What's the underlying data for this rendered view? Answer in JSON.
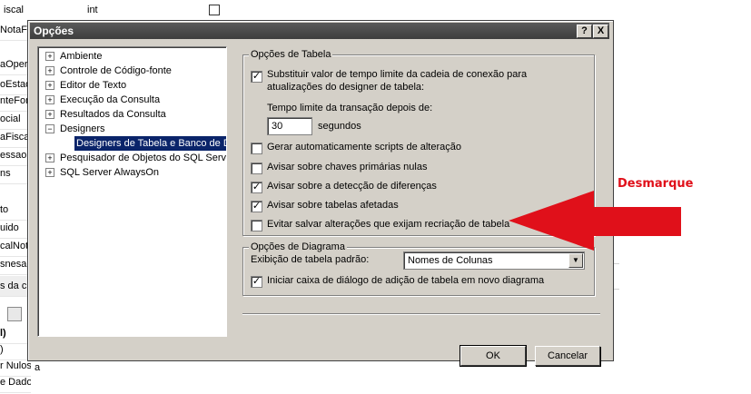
{
  "background": {
    "grid_cells": [
      "iscal",
      "int"
    ],
    "left_items": [
      "NotaFi",
      "aOpera",
      "oEstad",
      "nteForn",
      "ocial",
      "aFiscal",
      "essaoN",
      "ns",
      "to",
      "uido",
      "calNota",
      "snesa",
      "s da c",
      "l)",
      ")",
      "r Nulos",
      "e Dado"
    ],
    "bottom_text": "a"
  },
  "dialog": {
    "title": "Opções",
    "help_btn": "?",
    "close_btn": "X",
    "tree": [
      {
        "label": "Ambiente",
        "expander": "+"
      },
      {
        "label": "Controle de Código-fonte",
        "expander": "+"
      },
      {
        "label": "Editor de Texto",
        "expander": "+"
      },
      {
        "label": "Execução da Consulta",
        "expander": "+"
      },
      {
        "label": "Resultados da Consulta",
        "expander": "+"
      },
      {
        "label": "Designers",
        "expander": "−"
      },
      {
        "label": "Designers de Tabela e Banco de D",
        "expander": ""
      },
      {
        "label": "Pesquisador de Objetos do SQL Serve",
        "expander": "+"
      },
      {
        "label": "SQL Server AlwaysOn",
        "expander": "+"
      }
    ],
    "table_group": {
      "legend": "Opções de Tabela",
      "opt1_line1": "Substituir valor de tempo limite da cadeia de conexão para",
      "opt1_line2": "atualizações do designer de tabela:",
      "opt1_checked": "✓",
      "timeout_label": "Tempo limite da transação depois de:",
      "timeout_value": "30",
      "timeout_unit": "segundos",
      "opt2": "Gerar automaticamente scripts de alteração",
      "opt3": "Avisar sobre chaves primárias nulas",
      "opt4": "Avisar sobre a detecção de diferenças",
      "opt4_checked": "✓",
      "opt5": "Avisar sobre tabelas afetadas",
      "opt5_checked": "✓",
      "opt6": "Evitar salvar alterações que exijam recriação de tabela"
    },
    "diagram_group": {
      "legend": "Opções de Diagrama",
      "default_view_label": "Exibição de tabela padrão:",
      "default_view_value": "Nomes de Colunas",
      "opt1": "Iniciar caixa de diálogo de adição de tabela em novo diagrama",
      "opt1_checked": "✓"
    },
    "ok": "OK",
    "cancel": "Cancelar"
  },
  "annotation": {
    "text": "Desmarque",
    "color": "#e0101a"
  }
}
